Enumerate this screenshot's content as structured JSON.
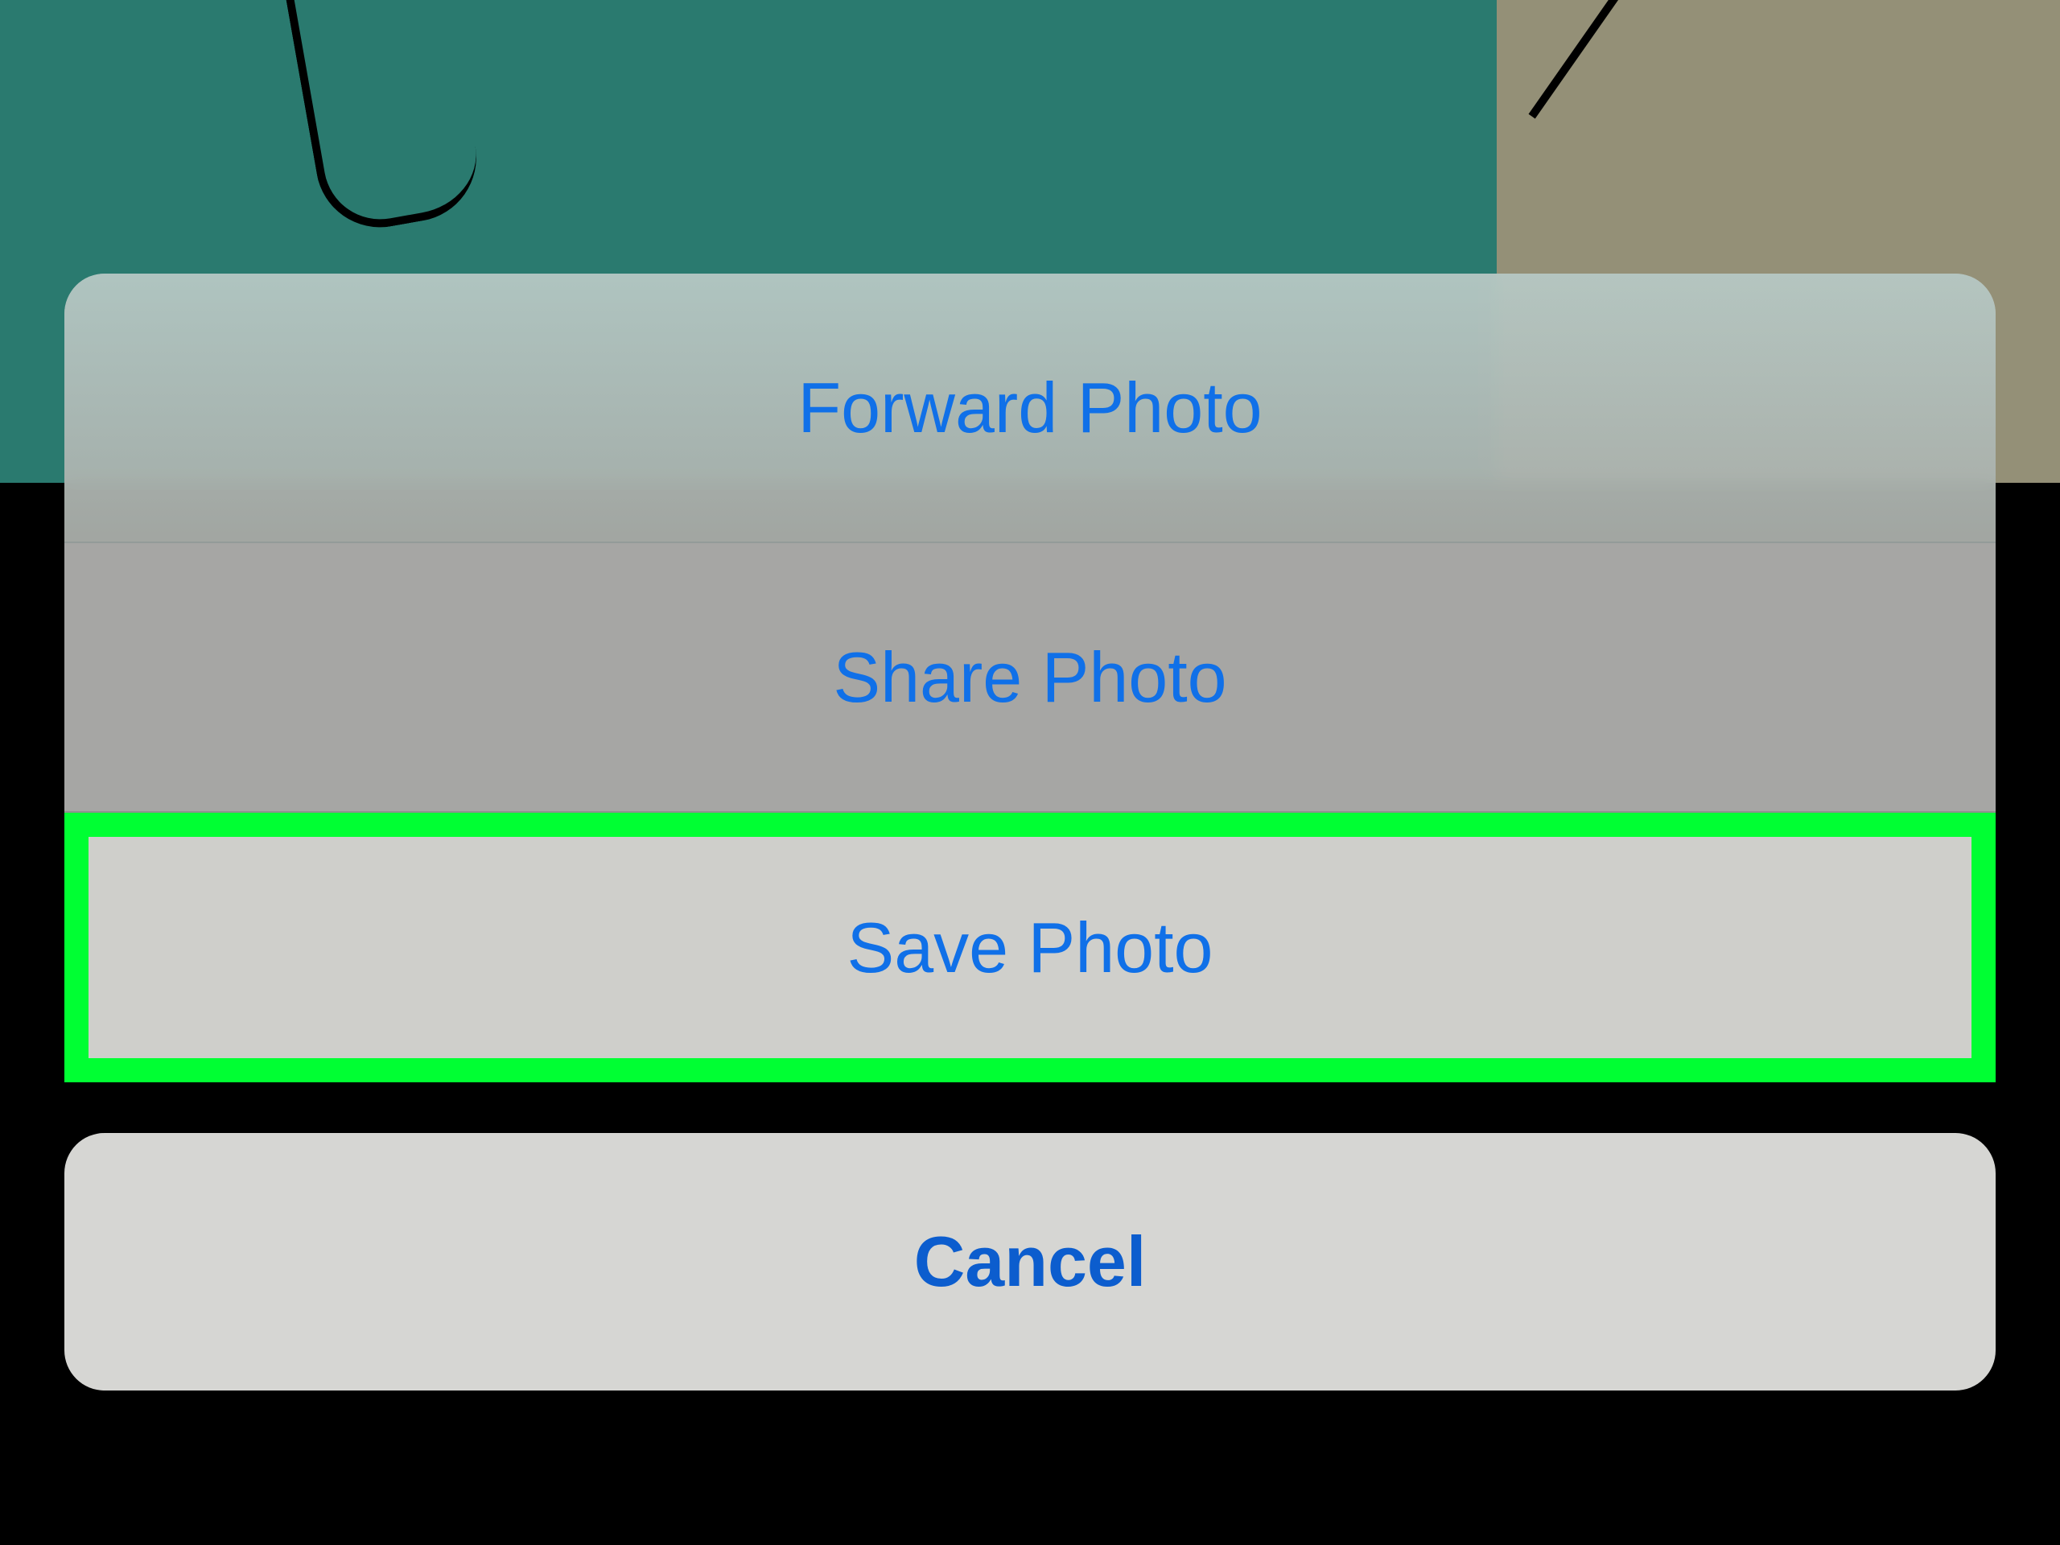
{
  "actionSheet": {
    "options": [
      {
        "label": "Forward Photo"
      },
      {
        "label": "Share Photo"
      },
      {
        "label": "Save Photo"
      }
    ],
    "cancel": {
      "label": "Cancel"
    }
  },
  "highlight": {
    "color": "#00ff33"
  }
}
